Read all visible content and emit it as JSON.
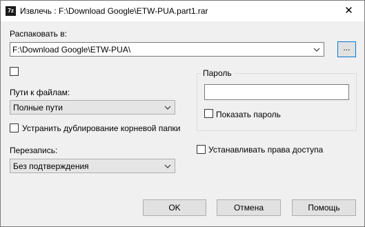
{
  "window": {
    "icon_text": "7z",
    "title": "Извлечь : F:\\Download Google\\ETW-PUA.part1.rar",
    "close_glyph": "✕"
  },
  "extract_to": {
    "label": "Распаковать в:",
    "value": "F:\\Download Google\\ETW-PUA\\",
    "browse_label": "..."
  },
  "paths": {
    "label": "Пути к файлам:",
    "value": "Полные пути",
    "eliminate_duplication_label": "Устранить дублирование корневой папки"
  },
  "overwrite": {
    "label": "Перезапись:",
    "value": "Без подтверждения"
  },
  "password": {
    "group_label": "Пароль",
    "value": "",
    "show_password_label": "Показать пароль"
  },
  "security": {
    "set_permissions_label": "Устанавливать права доступа"
  },
  "buttons": {
    "ok": "OK",
    "cancel": "Отмена",
    "help": "Помощь"
  }
}
